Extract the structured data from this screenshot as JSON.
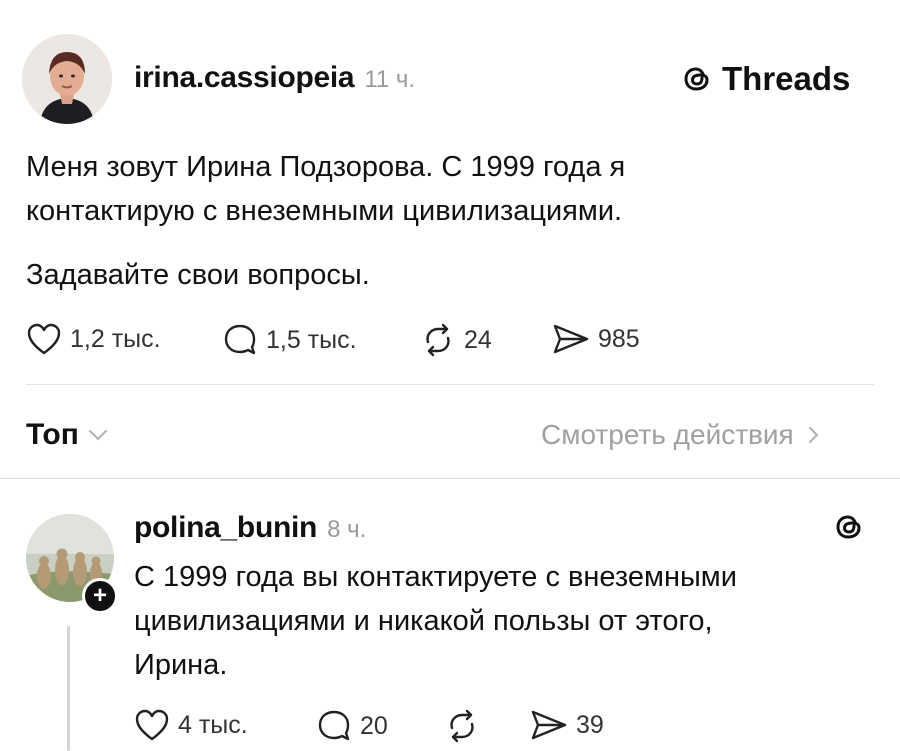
{
  "post": {
    "author": "irina.cassiopeia",
    "time": "11 ч.",
    "brand": "Threads",
    "paragraph1_line1": "Меня зовут Ирина Подзорова. С 1999 года я",
    "paragraph1_line2": "контактирую с внеземными цивилизациями.",
    "paragraph2": "Задавайте свои вопросы.",
    "likes": "1,2 тыс.",
    "comments": "1,5 тыс.",
    "reposts": "24",
    "shares": "985"
  },
  "sort_bar": {
    "sort_label": "Топ",
    "view_activity": "Смотреть действия"
  },
  "reply": {
    "author": "polina_bunin",
    "time": "8 ч.",
    "plus": "+",
    "line1": "С 1999 года вы контактируете с внеземными",
    "line2": "цивилизациями и никакой пользы от этого,",
    "line3": "Ирина.",
    "likes": "4 тыс.",
    "comments": "20",
    "shares": "39"
  }
}
